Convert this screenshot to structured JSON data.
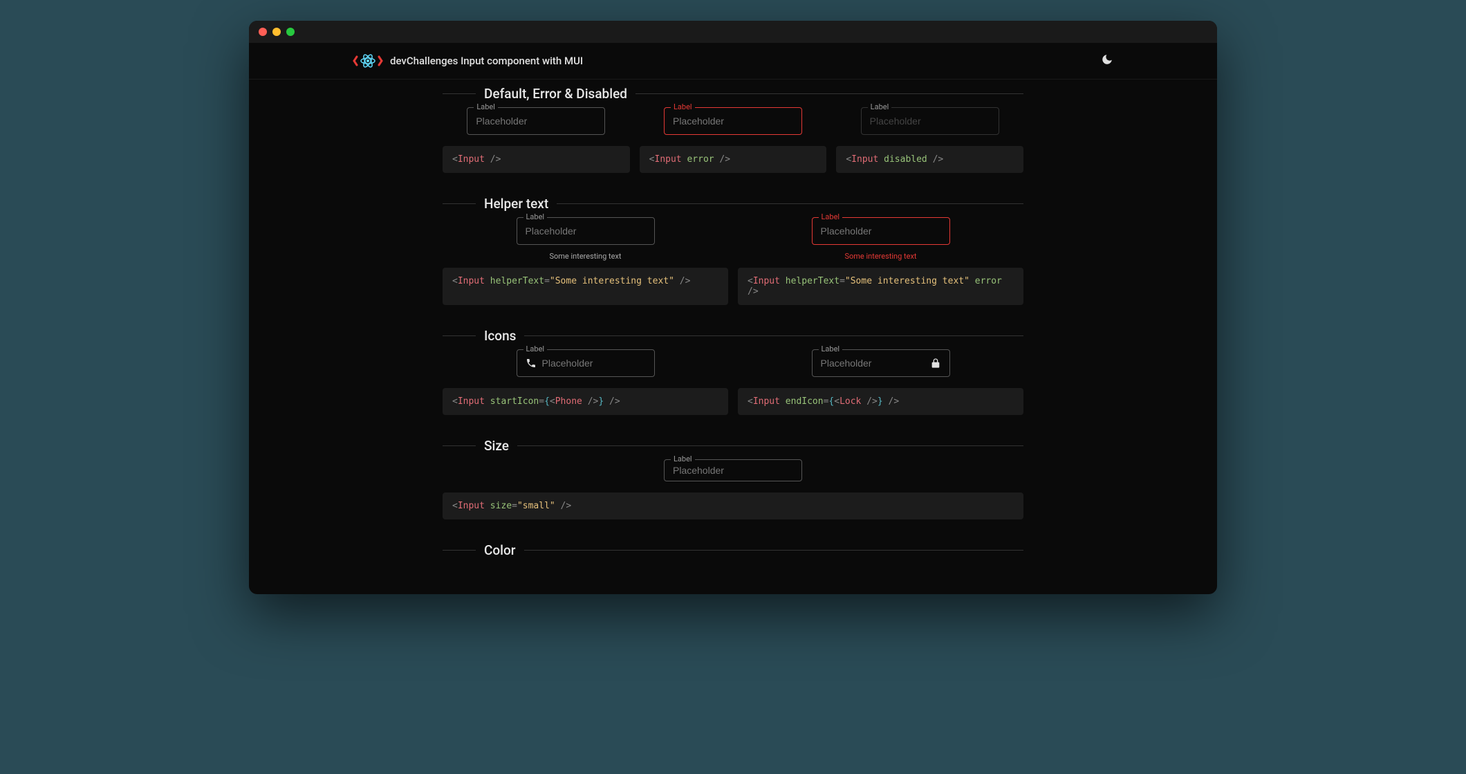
{
  "header": {
    "app_title": "devChallenges Input component with MUI"
  },
  "sections": {
    "default_error_disabled": {
      "title": "Default, Error & Disabled",
      "items": [
        {
          "label": "Label",
          "placeholder": "Placeholder",
          "code_tag": "Input",
          "code_attr": "",
          "code_close": " />"
        },
        {
          "label": "Label",
          "placeholder": "Placeholder",
          "code_tag": "Input",
          "code_attr": "error",
          "code_close": " />"
        },
        {
          "label": "Label",
          "placeholder": "Placeholder",
          "code_tag": "Input",
          "code_attr": "disabled",
          "code_close": " />"
        }
      ]
    },
    "helper_text": {
      "title": "Helper text",
      "items": [
        {
          "label": "Label",
          "placeholder": "Placeholder",
          "helper": "Some interesting text",
          "code_tag": "Input",
          "code_attr": "helperText",
          "code_eq": "=",
          "code_str": "\"Some interesting text\"",
          "code_close": " />"
        },
        {
          "label": "Label",
          "placeholder": "Placeholder",
          "helper": "Some interesting text",
          "code_tag": "Input",
          "code_attr": "helperText",
          "code_eq": "=",
          "code_str": "\"Some interesting text\"",
          "code_extra": " error",
          "code_close": " />"
        }
      ]
    },
    "icons": {
      "title": "Icons",
      "items": [
        {
          "label": "Label",
          "placeholder": "Placeholder",
          "code_tag": "Input",
          "code_attr": "startIcon",
          "code_eq": "=",
          "inner_tag": "Phone",
          "code_close": " />"
        },
        {
          "label": "Label",
          "placeholder": "Placeholder",
          "code_tag": "Input",
          "code_attr": "endIcon",
          "code_eq": "=",
          "inner_tag": "Lock",
          "code_close": " />"
        }
      ]
    },
    "size": {
      "title": "Size",
      "items": [
        {
          "label": "Label",
          "placeholder": "Placeholder",
          "code_tag": "Input",
          "code_attr": "size",
          "code_eq": "=",
          "code_str": "\"small\"",
          "code_close": " />"
        }
      ]
    },
    "color": {
      "title": "Color"
    }
  }
}
